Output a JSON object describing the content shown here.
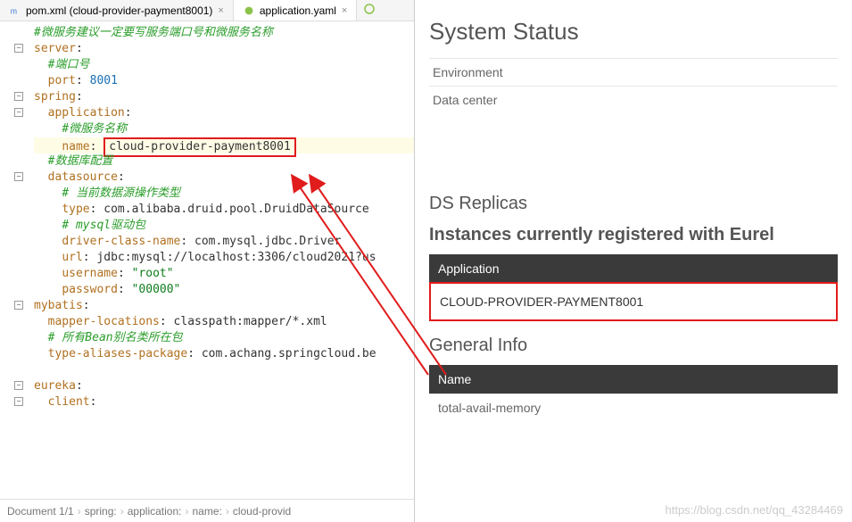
{
  "tabs": [
    {
      "label": "pom.xml (cloud-provider-payment8001)",
      "icon_color": "#3a76d6"
    },
    {
      "label": "application.yaml",
      "icon_color": "#8bc34a"
    }
  ],
  "code": {
    "l1": "#微服务建议一定要写服务端口号和微服务名称",
    "l2_key": "server",
    "l3": "#端口号",
    "l4_key": "port",
    "l4_val": "8001",
    "l5_key": "spring",
    "l6_key": "application",
    "l7": "#微服务名称",
    "l8_key": "name",
    "l8_val": "cloud-provider-payment8001",
    "l9": "#数据库配置",
    "l10_key": "datasource",
    "l11": "# 当前数据源操作类型",
    "l12_key": "type",
    "l12_val": "com.alibaba.druid.pool.DruidDataSource",
    "l13": "# mysql驱动包",
    "l14_key": "driver-class-name",
    "l14_val": "com.mysql.jdbc.Driver",
    "l15_key": "url",
    "l15_val": "jdbc:mysql://localhost:3306/cloud2021?us",
    "l16_key": "username",
    "l16_val": "\"root\"",
    "l17_key": "password",
    "l17_val": "\"00000\"",
    "l18_key": "mybatis",
    "l19_key": "mapper-locations",
    "l19_val": "classpath:mapper/*.xml",
    "l20": "# 所有Bean别名类所在包",
    "l21_key": "type-aliases-package",
    "l21_val": "com.achang.springcloud.be",
    "l22_key": "eureka",
    "l23_key": "client"
  },
  "breadcrumbs": {
    "doc": "Document 1/1",
    "p1": "spring:",
    "p2": "application:",
    "p3": "name:",
    "p4": "cloud-provid"
  },
  "eureka": {
    "system_status": "System Status",
    "env": "Environment",
    "dc": "Data center",
    "ds_replicas": "DS Replicas",
    "instances_title": "Instances currently registered with Eurel",
    "app_header": "Application",
    "app_name": "CLOUD-PROVIDER-PAYMENT8001",
    "general_info": "General Info",
    "name_header": "Name",
    "mem": "total-avail-memory"
  },
  "watermark": "https://blog.csdn.net/qq_43284469"
}
